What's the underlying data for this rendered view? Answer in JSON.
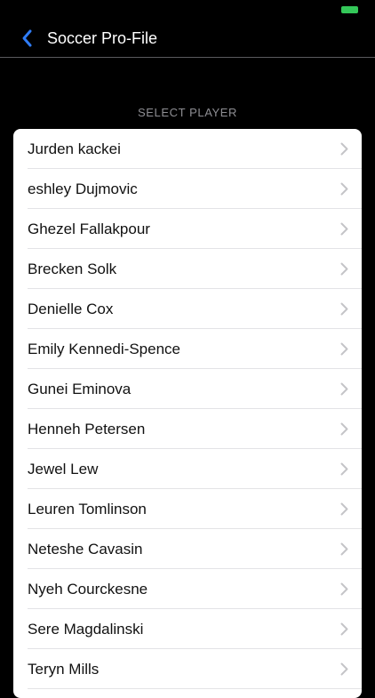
{
  "status_bar": {
    "battery_color": "#34c759"
  },
  "nav": {
    "back_icon": "chevron-left-icon",
    "title": "Soccer Pro-File",
    "accent": "#2f7cf6"
  },
  "section": {
    "header": "SELECT PLAYER"
  },
  "players": [
    "Jurden kackei",
    "eshley Dujmovic",
    "Ghezel Fallakpour",
    "Brecken Solk",
    "Denielle Cox",
    "Emily Kennedi-Spence",
    "Gunei Eminova",
    "Henneh Petersen",
    "Jewel Lew",
    "Leuren Tomlinson",
    "Neteshe Cavasin",
    "Nyeh Courckesne",
    "Sere Magdalinski",
    "Teryn Mills"
  ],
  "row_icon": "chevron-right-icon"
}
